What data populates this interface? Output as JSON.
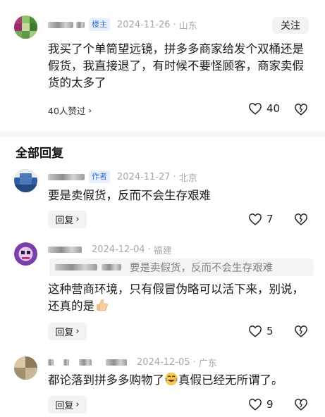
{
  "top_comment": {
    "badge": "楼主",
    "time": "2024-11-26",
    "location": "山东",
    "follow_label": "关注",
    "text": "我买了个单筒望远镜，拼多多商家给发个双桶还是假货，我直接退了，有时候不要怪顾客，商家卖假货的太多了",
    "likers_label": "40人赞过",
    "likes": "40"
  },
  "section_title": "全部回复",
  "replies": [
    {
      "badge": "作者",
      "time": "2024-11-27",
      "location": "北京",
      "text": "要是卖假货，反而不会生存艰难",
      "reply_label": "回复",
      "likes": "7"
    },
    {
      "time": "2024-12-04",
      "location": "福建",
      "quote": "要是卖假货，反而不会生存艰难",
      "text": "这种营商环境，只有假冒伪略可以活下来，别说，还真的是",
      "emoji": "thumbs-up-emoji",
      "reply_label": "回复",
      "likes": "5"
    },
    {
      "time": "2024-12-05",
      "location": "广东",
      "text_before": "都论落到拼多多购物了",
      "emoji": "rolling-laugh-emoji",
      "text_after": "真假已经无所谓了。",
      "reply_label": "回复",
      "likes": "9"
    }
  ],
  "colors": {
    "badge_blue": "#3a6fd8",
    "meta_gray": "#a8a8a8",
    "button_bg": "#f2f2f2"
  }
}
